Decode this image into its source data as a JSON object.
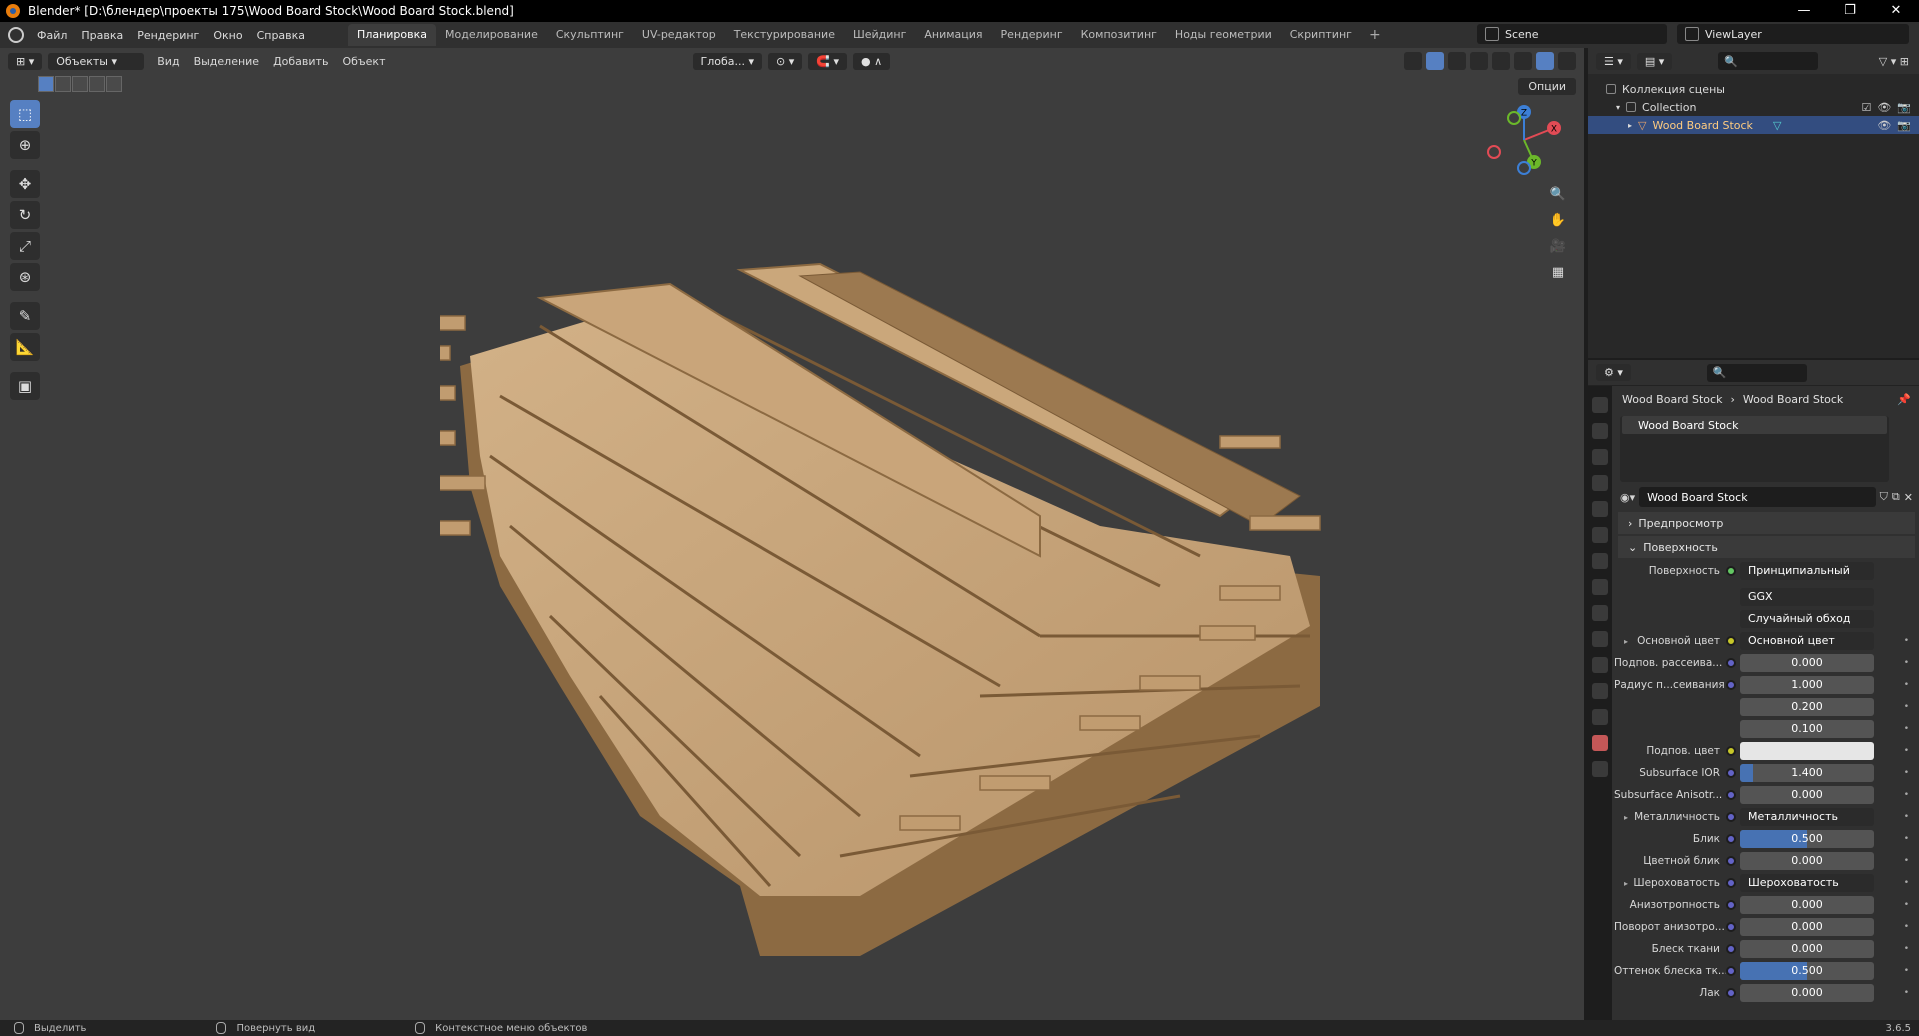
{
  "window": {
    "title": "Blender* [D:\\блендер\\проекты 175\\Wood Board Stock\\Wood Board Stock.blend]",
    "controls": [
      "—",
      "❐",
      "✕"
    ]
  },
  "menubar": {
    "menus": [
      "Файл",
      "Правка",
      "Рендеринг",
      "Окно",
      "Справка"
    ],
    "workspaces": [
      "Планировка",
      "Моделирование",
      "Скульптинг",
      "UV-редактор",
      "Текстурирование",
      "Шейдинг",
      "Анимация",
      "Рендеринг",
      "Композитинг",
      "Ноды геометрии",
      "Скриптинг"
    ],
    "active_workspace": "Планировка",
    "add_tab": "+",
    "scene": "Scene",
    "view_layer": "ViewLayer"
  },
  "viewport": {
    "mode": "Объекты",
    "menus": [
      "Вид",
      "Выделение",
      "Добавить",
      "Объект"
    ],
    "orientation": "Глоба...",
    "options": "Опции",
    "tools": [
      "select-box",
      "cursor",
      "move",
      "rotate",
      "scale",
      "transform",
      "annotate",
      "measure",
      "add-cube"
    ],
    "gizmo_axes": [
      "X",
      "Y",
      "Z"
    ]
  },
  "outliner": {
    "root": "Коллекция сцены",
    "collection": "Collection",
    "object": "Wood Board Stock"
  },
  "properties": {
    "breadcrumb_object": "Wood Board Stock",
    "breadcrumb_material": "Wood Board Stock",
    "slot": "Wood Board Stock",
    "material_name": "Wood Board Stock",
    "panels": {
      "preview": "Предпросмотр",
      "surface": "Поверхность"
    },
    "surface_label": "Поверхность",
    "surface_shader": "Принципиальный BSDF",
    "distribution": "GGX",
    "subsurface_method": "Случайный обход",
    "rows": [
      {
        "label": "Основной цвет",
        "value": "Основной цвет",
        "kind": "link",
        "dot": "y",
        "expand": true
      },
      {
        "label": "Подпов. рассеива...",
        "value": "0.000",
        "kind": "num",
        "dot": "b",
        "fill": 0
      },
      {
        "label": "Радиус п...сеивания",
        "value": "1.000",
        "kind": "num",
        "dot": "b",
        "fill": 0
      },
      {
        "label": "",
        "value": "0.200",
        "kind": "num",
        "dot": "",
        "fill": 0
      },
      {
        "label": "",
        "value": "0.100",
        "kind": "num",
        "dot": "",
        "fill": 0
      },
      {
        "label": "Подпов. цвет",
        "value": "",
        "kind": "color",
        "dot": "y",
        "fill": 0
      },
      {
        "label": "Subsurface IOR",
        "value": "1.400",
        "kind": "num",
        "dot": "b",
        "fill": 0.1
      },
      {
        "label": "Subsurface Anisotr...",
        "value": "0.000",
        "kind": "num",
        "dot": "b",
        "fill": 0
      },
      {
        "label": "Металличность",
        "value": "Металличность",
        "kind": "link",
        "dot": "b",
        "expand": true
      },
      {
        "label": "Блик",
        "value": "0.500",
        "kind": "num",
        "dot": "b",
        "fill": 0.5
      },
      {
        "label": "Цветной блик",
        "value": "0.000",
        "kind": "num",
        "dot": "b",
        "fill": 0
      },
      {
        "label": "Шероховатость",
        "value": "Шероховатость",
        "kind": "link",
        "dot": "b",
        "expand": true
      },
      {
        "label": "Анизотропность",
        "value": "0.000",
        "kind": "num",
        "dot": "b",
        "fill": 0
      },
      {
        "label": "Поворот анизотро...",
        "value": "0.000",
        "kind": "num",
        "dot": "b",
        "fill": 0
      },
      {
        "label": "Блеск ткани",
        "value": "0.000",
        "kind": "num",
        "dot": "b",
        "fill": 0
      },
      {
        "label": "Оттенок блеска тк...",
        "value": "0.500",
        "kind": "num",
        "dot": "b",
        "fill": 0.5
      },
      {
        "label": "Лак",
        "value": "0.000",
        "kind": "num",
        "dot": "b",
        "fill": 0
      }
    ]
  },
  "status": {
    "select": "Выделить",
    "rotate": "Повернуть вид",
    "context": "Контекстное меню объектов",
    "version": "3.6.5"
  },
  "colors": {
    "accent": "#4772b3",
    "wood_light": "#c8a77c",
    "wood_dark": "#8c6a42",
    "viewport_bg": "#3d3d3d"
  }
}
